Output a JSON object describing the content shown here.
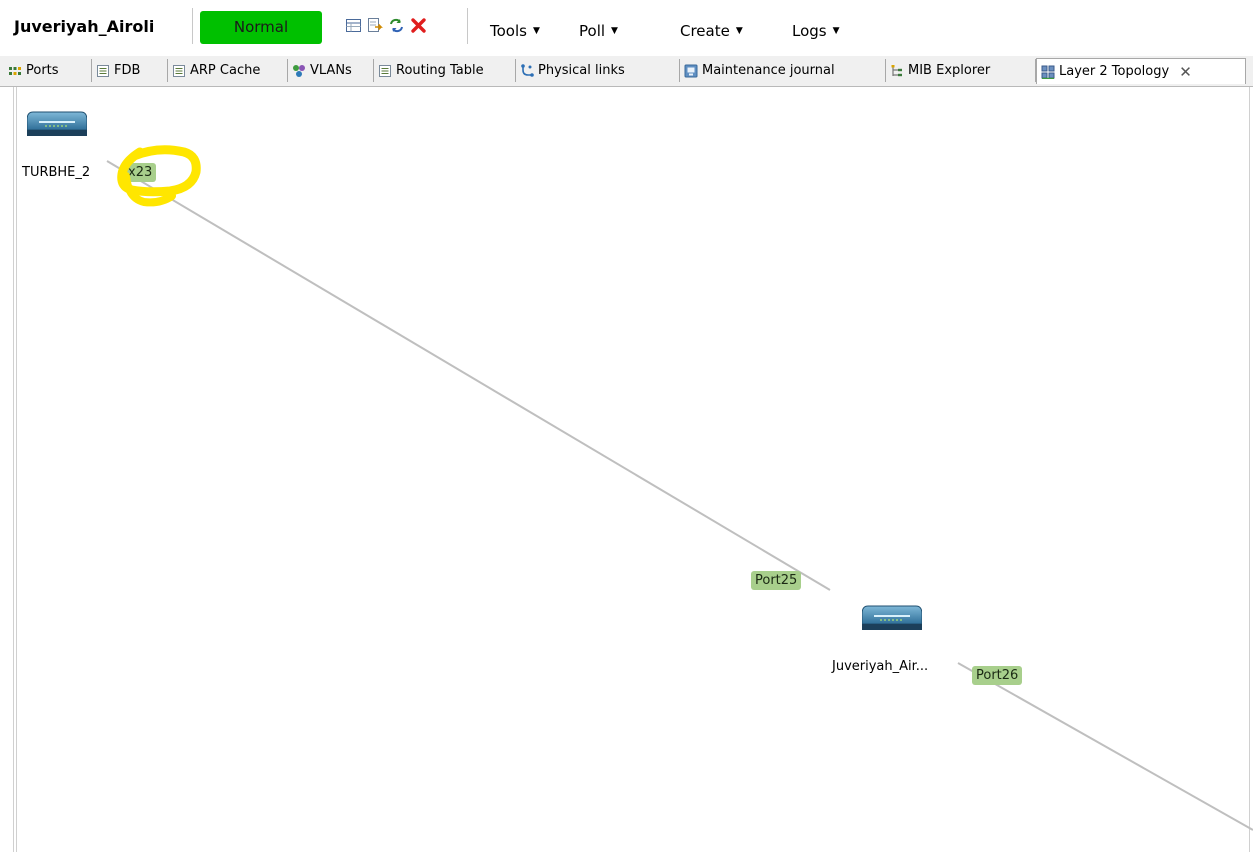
{
  "header": {
    "node_name": "Juveriyah_Airoli",
    "status": "Normal",
    "status_color": "#00c000",
    "icons": [
      "table-icon",
      "export-icon",
      "refresh-icon",
      "delete-icon"
    ],
    "menus": [
      {
        "label": "Tools"
      },
      {
        "label": "Poll"
      },
      {
        "label": "Create"
      },
      {
        "label": "Logs"
      }
    ]
  },
  "tabs": [
    {
      "label": "Ports",
      "icon": "ports-icon"
    },
    {
      "label": "FDB",
      "icon": "list-icon"
    },
    {
      "label": "ARP Cache",
      "icon": "list-icon"
    },
    {
      "label": "VLANs",
      "icon": "vlans-icon"
    },
    {
      "label": "Routing Table",
      "icon": "list-icon"
    },
    {
      "label": "Physical links",
      "icon": "link-icon"
    },
    {
      "label": "Maintenance journal",
      "icon": "journal-icon"
    },
    {
      "label": "MIB Explorer",
      "icon": "tree-icon"
    },
    {
      "label": "Layer 2 Topology",
      "icon": "topology-icon",
      "active": true
    }
  ],
  "topology": {
    "nodes": [
      {
        "id": "turbhe",
        "label": "TURBHE_2"
      },
      {
        "id": "airoli",
        "label": "Juveriyah_Air..."
      }
    ],
    "ports": [
      {
        "label": "x23",
        "node": "TURBHE_2"
      },
      {
        "label": "Port25",
        "node": "Juveriyah_Air..."
      },
      {
        "label": "Port26",
        "node": "Juveriyah_Air..."
      }
    ],
    "link_color": "#bfbfbf",
    "port_badge_color": "#a8cf8c",
    "annotation_color": "#ffe600"
  }
}
